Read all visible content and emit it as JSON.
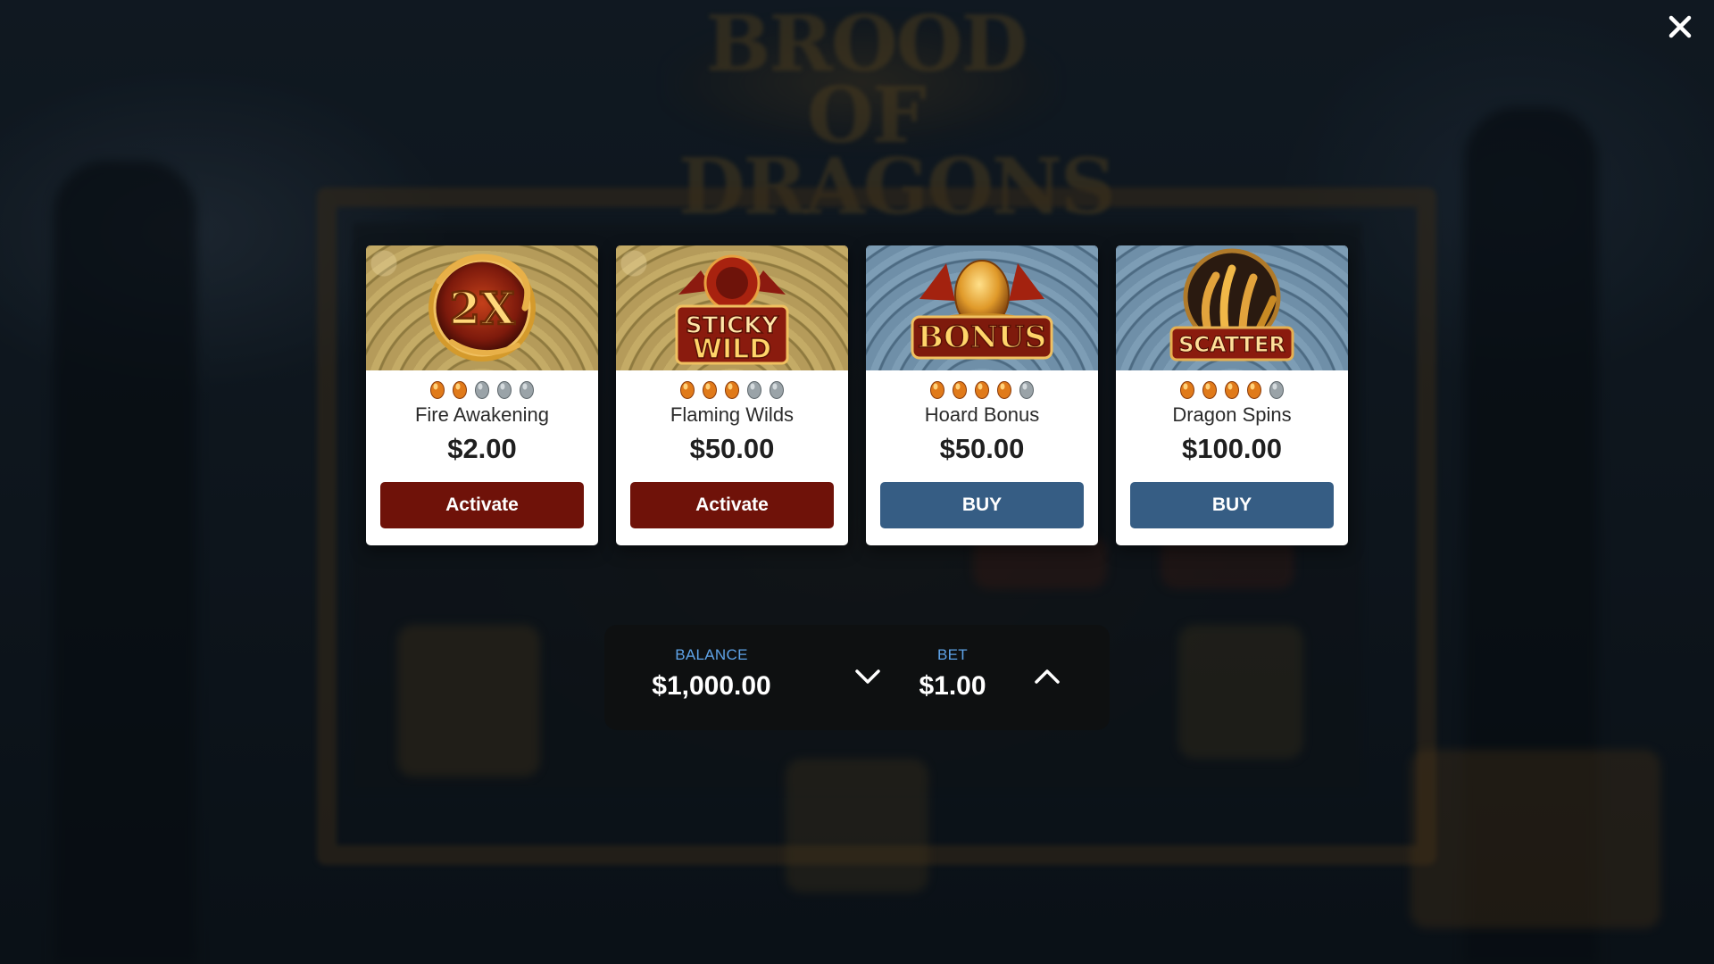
{
  "game": {
    "logo_text": "BROOD OF DRAGONS"
  },
  "close": {
    "icon": "close-icon"
  },
  "cards": [
    {
      "art": "2x-multiplier-icon",
      "art_text": "2X",
      "eggs_filled": 2,
      "eggs_total": 5,
      "name": "Fire Awakening",
      "price": "$2.00",
      "action": "Activate",
      "action_color": "#6f1209"
    },
    {
      "art": "sticky-wild-icon",
      "art_text": "STICKY WILD",
      "eggs_filled": 3,
      "eggs_total": 5,
      "name": "Flaming Wilds",
      "price": "$50.00",
      "action": "Activate",
      "action_color": "#6f1209"
    },
    {
      "art": "bonus-egg-icon",
      "art_text": "BONUS",
      "eggs_filled": 4,
      "eggs_total": 5,
      "name": "Hoard Bonus",
      "price": "$50.00",
      "action": "BUY",
      "action_color": "#365d84"
    },
    {
      "art": "scatter-claw-icon",
      "art_text": "SCATTER",
      "eggs_filled": 4,
      "eggs_total": 5,
      "name": "Dragon Spins",
      "price": "$100.00",
      "action": "BUY",
      "action_color": "#365d84"
    }
  ],
  "wallet": {
    "balance_label": "BALANCE",
    "balance_value": "$1,000.00",
    "bet_label": "BET",
    "bet_value": "$1.00",
    "decrease_icon": "chevron-down-icon",
    "increase_icon": "chevron-up-icon"
  },
  "colors": {
    "accent_label": "#5fa3e8",
    "activate": "#6f1209",
    "buy": "#365d84",
    "egg_filled": "#e07a1a",
    "egg_empty": "#9aa3a8"
  }
}
